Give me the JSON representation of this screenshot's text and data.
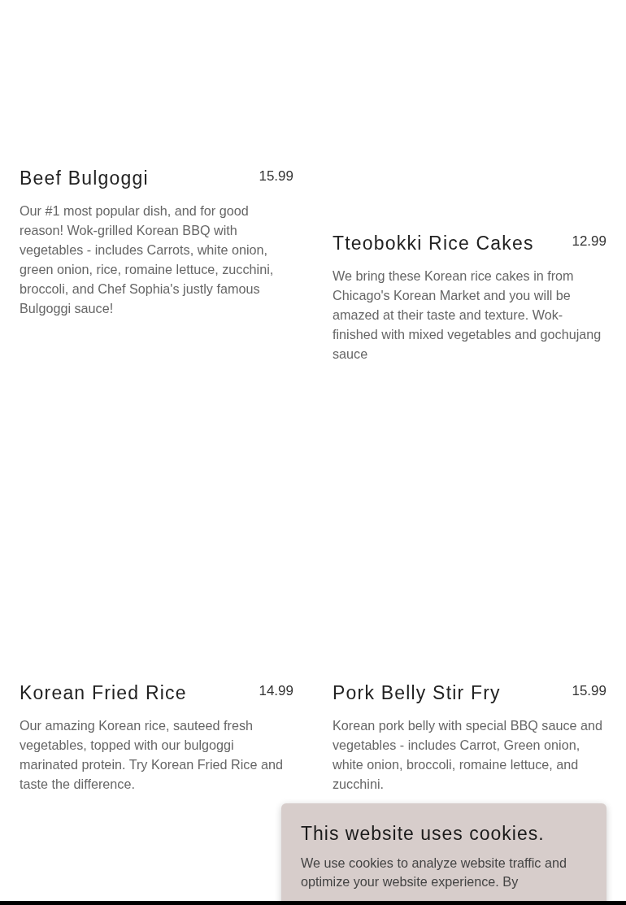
{
  "menu_items": [
    {
      "name": "Beef Bulgoggi",
      "price": "15.99",
      "description": "Our #1 most popular dish, and for good reason! Wok-grilled Korean BBQ with vegetables - includes Carrots, white onion, green onion, rice, romaine lettuce, zucchini, broccoli, and Chef Sophia's justly famous Bulgoggi sauce!"
    },
    {
      "name": "Tteobokki Rice Cakes",
      "price": "12.99",
      "description": "We bring these Korean rice cakes in from Chicago's Korean Market and you will be amazed at their taste and texture. Wok-finished with mixed vegetables and gochujang sauce"
    },
    {
      "name": "Korean Fried Rice",
      "price": "14.99",
      "description": "Our amazing Korean rice, sauteed fresh vegetables, topped with our bulgoggi marinated protein. Try Korean Fried Rice and taste the difference."
    },
    {
      "name": "Pork Belly Stir Fry",
      "price": "15.99",
      "description": "Korean pork belly with special BBQ sauce and vegetables - includes Carrot, Green onion, white onion, broccoli, romaine lettuce, and zucchini."
    }
  ],
  "cookie_banner": {
    "title": "This website uses cookies.",
    "text": "We use cookies to analyze website traffic and optimize your website experience. By"
  }
}
